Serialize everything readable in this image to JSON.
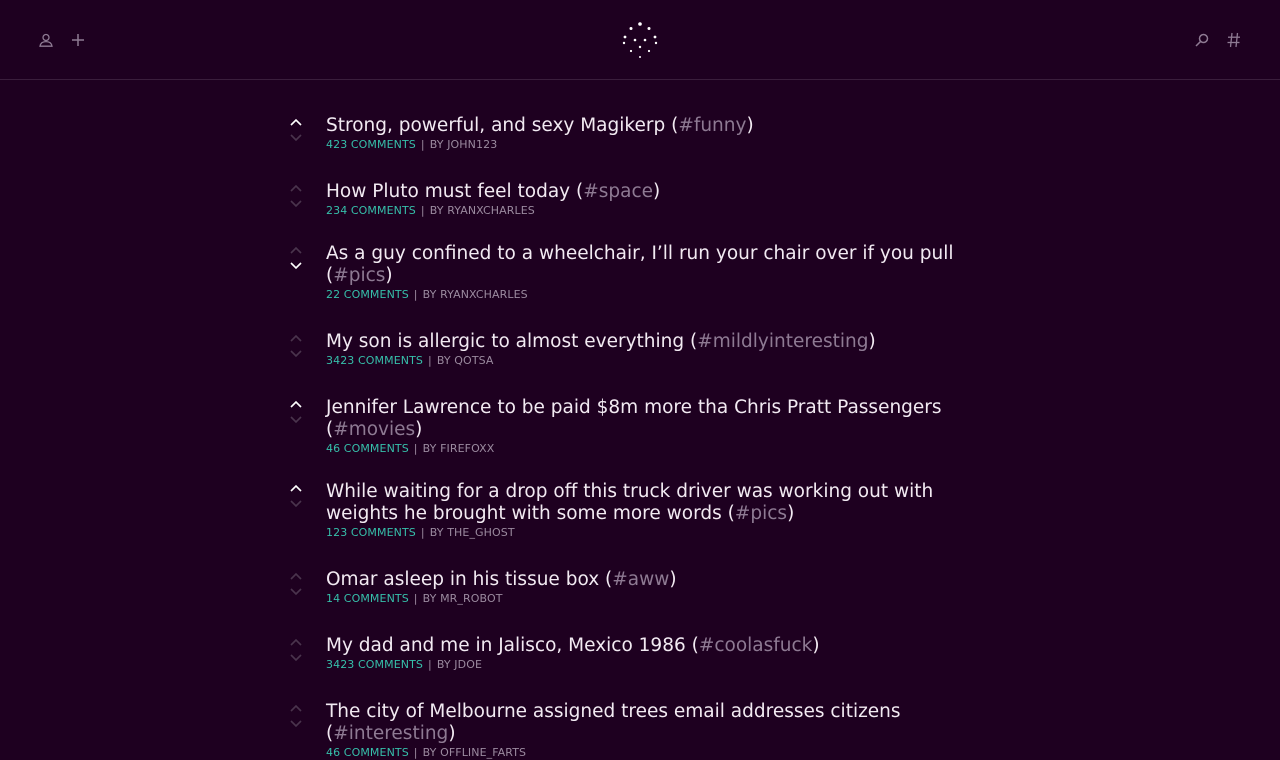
{
  "header": {
    "icons": {
      "user": "user-icon",
      "add": "plus-icon",
      "logo": "dots-logo-icon",
      "search": "search-icon",
      "tags": "hashtag-icon"
    }
  },
  "colors": {
    "background": "#1e0020",
    "title": "#f2eaf2",
    "tag": "#8e7a93",
    "comments": "#36bfaa",
    "meta": "#9b8a9f",
    "vote_active": "#ffffff",
    "vote_inactive": "#4a344d"
  },
  "posts": [
    {
      "title": "Strong, powerful, and sexy Magikerp",
      "tag": "#funny",
      "comments": "423 comments",
      "by": "by",
      "author": "john123",
      "vote": "up"
    },
    {
      "title": "How Pluto must feel today",
      "tag": "#space",
      "comments": "234 comments",
      "by": "by",
      "author": "ryanxcharles",
      "vote": "none"
    },
    {
      "title": "As a guy confined to a wheelchair, I’ll run your chair over if you pull",
      "tag": "#pics",
      "comments": "22 comments",
      "by": "by",
      "author": "ryanxcharles",
      "vote": "down"
    },
    {
      "title": "My son is allergic to almost everything",
      "tag": "#mildlyinteresting",
      "comments": "3423 comments",
      "by": "by",
      "author": "qotsa",
      "vote": "none"
    },
    {
      "title": "Jennifer Lawrence to be paid $8m more tha Chris Pratt Passengers",
      "tag": "#movies",
      "comments": "46 comments",
      "by": "by",
      "author": "firefoxx",
      "vote": "up"
    },
    {
      "title": "While waiting for a drop off this truck driver was working out with weights he brought with some more words",
      "tag": "#pics",
      "comments": "123 comments",
      "by": "by",
      "author": "the_ghost",
      "vote": "up"
    },
    {
      "title": "Omar asleep in his tissue box",
      "tag": "#aww",
      "comments": "14 comments",
      "by": "by",
      "author": "mr_robot",
      "vote": "none"
    },
    {
      "title": "My dad and me in Jalisco, Mexico 1986",
      "tag": "#coolasfuck",
      "comments": "3423 comments",
      "by": "by",
      "author": "jdoe",
      "vote": "none"
    },
    {
      "title": "The city of Melbourne assigned trees email addresses citizens",
      "tag": "#interesting",
      "comments": "46 comments",
      "by": "by",
      "author": "offline_farts",
      "vote": "none"
    }
  ]
}
